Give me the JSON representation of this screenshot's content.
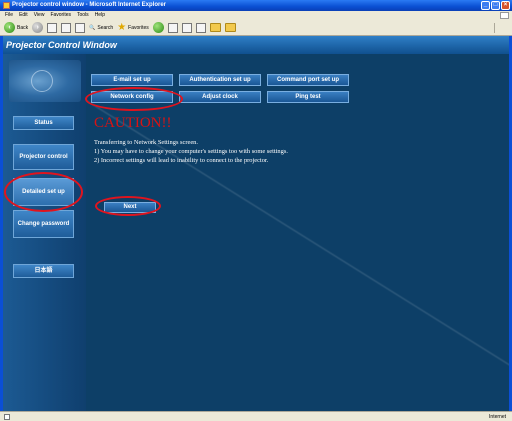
{
  "window": {
    "title": "Projector control window - Microsoft Internet Explorer"
  },
  "menubar": {
    "items": [
      "File",
      "Edit",
      "View",
      "Favorites",
      "Tools",
      "Help"
    ]
  },
  "toolbar": {
    "back_label": "Back",
    "search_label": "Search",
    "favorites_label": "Favorites"
  },
  "page": {
    "header_title": "Projector Control Window"
  },
  "sidebar": {
    "items": [
      {
        "label": "Status"
      },
      {
        "label": "Projector control"
      },
      {
        "label": "Detailed set up"
      },
      {
        "label": "Change password"
      },
      {
        "label": "日本語"
      }
    ]
  },
  "tabs": {
    "row1": [
      "E-mail set up",
      "Authentication set up",
      "Command port set up"
    ],
    "row2": [
      "Network config",
      "Adjust clock",
      "Ping test"
    ]
  },
  "main": {
    "caution_title": "CAUTION!!",
    "intro": "Transferring to Network Settings screen.",
    "line1": "1)  You may have to change your computer's settings too with some settings.",
    "line2": "2)  Incorrect settings will lead to inability to connect to the projector.",
    "next_label": "Next"
  },
  "statusbar": {
    "zone": "Internet"
  },
  "colors": {
    "highlight_ring": "#e0141e",
    "caution": "#d81313",
    "content_bg": "#0d3f67"
  }
}
